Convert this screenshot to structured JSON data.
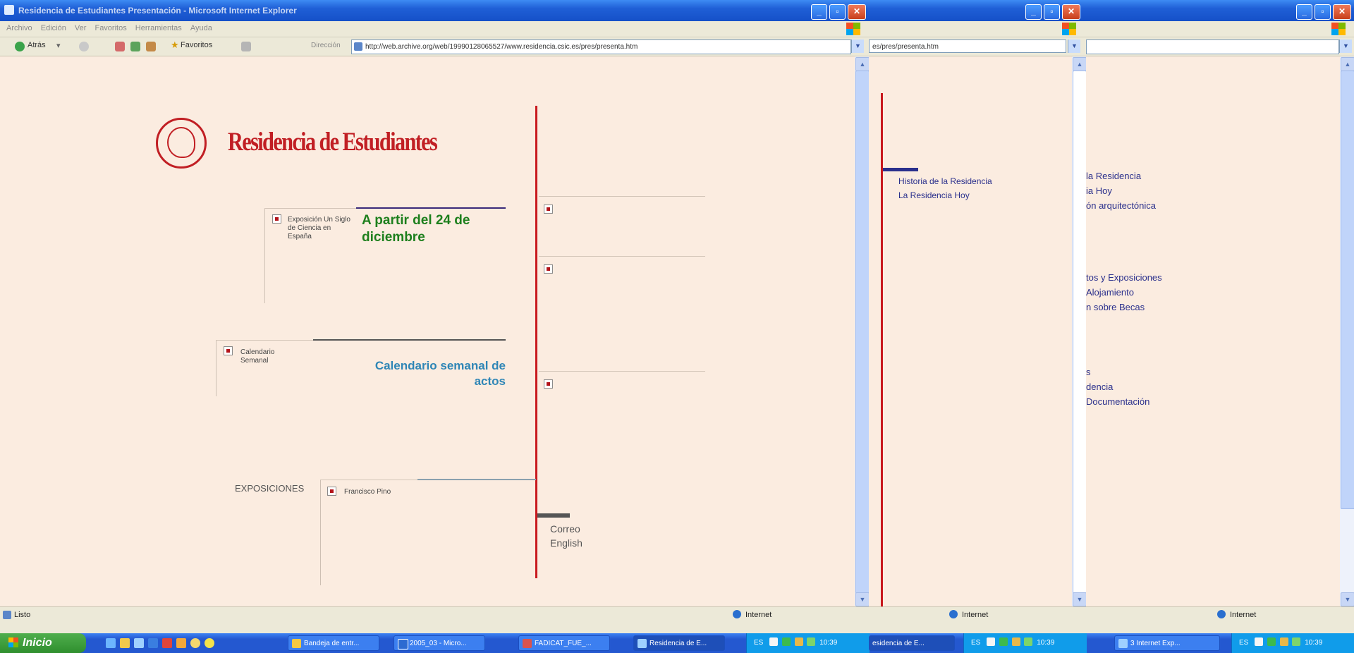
{
  "window1": {
    "title": "Residencia de Estudiantes Presentación - Microsoft Internet Explorer",
    "menu": [
      "Archivo",
      "Edición",
      "Ver",
      "Favoritos",
      "Herramientas",
      "Ayuda"
    ],
    "toolbar": {
      "back": "Atrás",
      "favorites": "Favoritos",
      "address_label": "Dirección"
    },
    "address": "http://web.archive.org/web/19990128065527/www.residencia.csic.es/pres/presenta.htm",
    "status": {
      "left": "Listo",
      "zone": "Internet"
    },
    "page": {
      "brand": "Residencia de Estudiantes",
      "expo_small": "Exposición Un Siglo de Ciencia en España",
      "expo_headline": "A partir del 24 de diciembre",
      "calendar_small": "Calendario Semanal",
      "calendar_headline": "Calendario semanal de actos",
      "exposiciones_label": "EXPOSICIONES",
      "pino_label": "Francisco Pino",
      "correo": "Correo",
      "english": "English"
    }
  },
  "window2": {
    "address": "es/pres/presenta.htm",
    "links": [
      "Historia de la Residencia",
      "La Residencia Hoy"
    ],
    "status_zone": "Internet"
  },
  "window3": {
    "links": [
      "la Residencia",
      "ia Hoy",
      "ón arquitectónica",
      "tos y Exposiciones",
      "Alojamiento",
      "n sobre Becas",
      "s",
      "dencia",
      "Documentación"
    ],
    "status_zone": "Internet"
  },
  "taskbar": {
    "start": "Inicio",
    "tasks": [
      "Bandeja de entr...",
      "2005_03 - Micro...",
      "FADICAT_FUE_...",
      "Residencia de E..."
    ],
    "task_w2": "esidencia de E...",
    "task_w3": "3 Internet Exp...",
    "tray_lang": "ES",
    "clock1": "10:39",
    "clock2": "10:39",
    "clock3": "10:39"
  },
  "colors": {
    "brand_red": "#c11f24",
    "page_bg": "#fbece0",
    "headline_green": "#1d7f1d",
    "headline_blue": "#2f86b6",
    "nav_link": "#2a2f8c"
  }
}
